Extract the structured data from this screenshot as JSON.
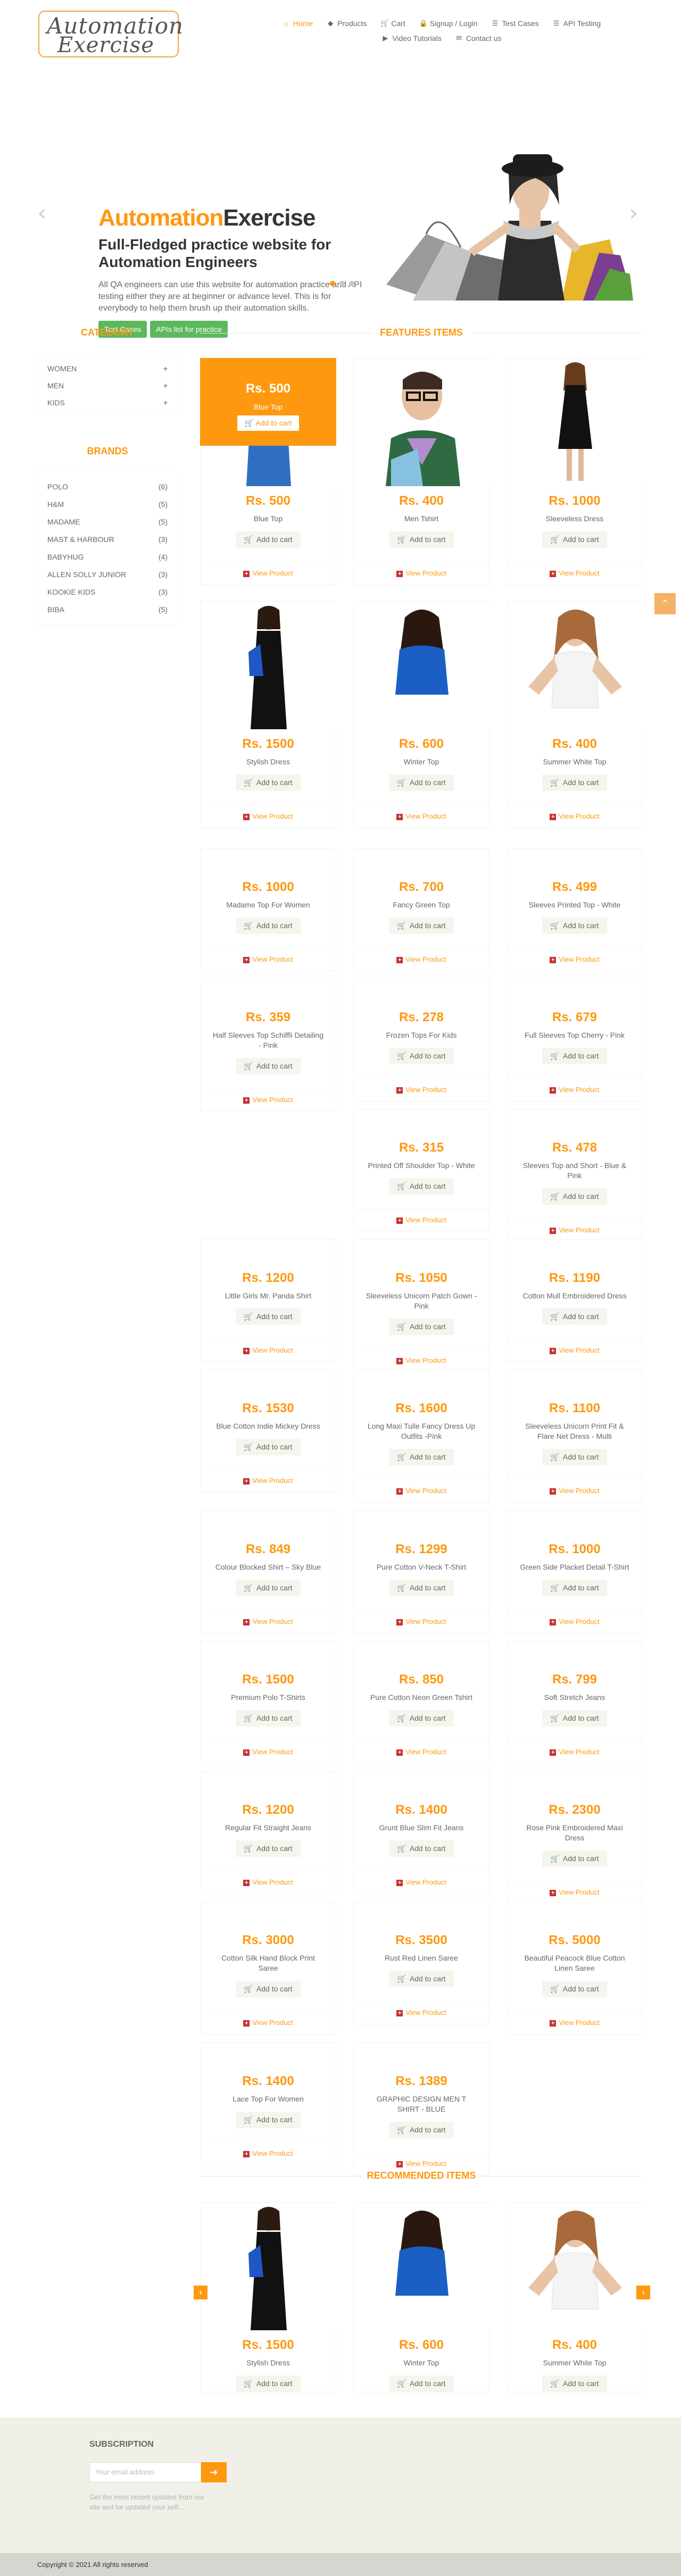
{
  "logo": {
    "line1": "Automation",
    "line2": "Exercise"
  },
  "nav": [
    {
      "label": "Home",
      "icon": "home-icon",
      "glyph": "⌂",
      "active": true
    },
    {
      "label": "Products",
      "icon": "tag-icon",
      "glyph": "◆",
      "active": false
    },
    {
      "label": "Cart",
      "icon": "cart-icon",
      "glyph": "🛒",
      "active": false
    },
    {
      "label": "Signup / Login",
      "icon": "lock-icon",
      "glyph": "🔒",
      "active": false
    },
    {
      "label": "Test Cases",
      "icon": "list-icon",
      "glyph": "☰",
      "active": false
    },
    {
      "label": "API Testing",
      "icon": "list-icon",
      "glyph": "☰",
      "active": false
    },
    {
      "label": "Video Tutorials",
      "icon": "youtube-icon",
      "glyph": "▶",
      "active": false
    },
    {
      "label": "Contact us",
      "icon": "envelope-icon",
      "glyph": "✉",
      "active": false
    }
  ],
  "slider": {
    "brand_a": "Automation",
    "brand_b": "Exercise",
    "subtitle": "Full-Fledged practice website for Automation Engineers",
    "description": "All QA engineers can use this website for automation practice and API testing either they are at beginner or advance level. This is for everybody to help them brush up their automation skills.",
    "btn_test_cases": "Test Cases",
    "btn_apis": "APIs list for practice",
    "arrow_left": "‹",
    "arrow_right": "›"
  },
  "sidebar": {
    "category_title": "CATEGORY",
    "categories": [
      "WOMEN",
      "MEN",
      "KIDS"
    ],
    "brands_title": "BRANDS",
    "brands": [
      {
        "name": "POLO",
        "count": "(6)"
      },
      {
        "name": "H&M",
        "count": "(5)"
      },
      {
        "name": "MADAME",
        "count": "(5)"
      },
      {
        "name": "MAST & HARBOUR",
        "count": "(3)"
      },
      {
        "name": "BABYHUG",
        "count": "(4)"
      },
      {
        "name": "ALLEN SOLLY JUNIOR",
        "count": "(3)"
      },
      {
        "name": "KOOKIE KIDS",
        "count": "(3)"
      },
      {
        "name": "BIBA",
        "count": "(5)"
      }
    ]
  },
  "features_title": "FEATURES ITEMS",
  "add_to_cart": "Add to cart",
  "view_product": "View Product",
  "overlay": {
    "price": "Rs. 500",
    "name": "Blue Top",
    "btn": "Add to cart"
  },
  "products": [
    {
      "price": "Rs. 500",
      "name": "Blue Top",
      "img": "blue-top",
      "active": true
    },
    {
      "price": "Rs. 400",
      "name": "Men Tshirt",
      "img": "men-tshirt"
    },
    {
      "price": "Rs. 1000",
      "name": "Sleeveless Dress",
      "img": "sleeveless-dress"
    },
    {
      "price": "Rs. 1500",
      "name": "Stylish Dress",
      "img": "stylish-dress"
    },
    {
      "price": "Rs. 600",
      "name": "Winter Top",
      "img": "winter-top"
    },
    {
      "price": "Rs. 400",
      "name": "Summer White Top",
      "img": "summer-white-top"
    },
    {
      "price": "Rs. 1000",
      "name": "Madame Top For Women"
    },
    {
      "price": "Rs. 700",
      "name": "Fancy Green Top"
    },
    {
      "price": "Rs. 499",
      "name": "Sleeves Printed Top - White"
    },
    {
      "price": "Rs. 359",
      "name": "Half Sleeves Top Schiffli Detailing - Pink"
    },
    {
      "price": "Rs. 278",
      "name": "Frozen Tops For Kids"
    },
    {
      "price": "Rs. 679",
      "name": "Full Sleeves Top Cherry - Pink"
    },
    {
      "price": "Rs. 315",
      "name": "Printed Off Shoulder Top - White"
    },
    {
      "price": "Rs. 478",
      "name": "Sleeves Top and Short - Blue & Pink"
    },
    {
      "price": "Rs. 1200",
      "name": "Little Girls Mr. Panda Shirt"
    },
    {
      "price": "Rs. 1050",
      "name": "Sleeveless Unicorn Patch Gown - Pink"
    },
    {
      "price": "Rs. 1190",
      "name": "Cotton Mull Embroidered Dress"
    },
    {
      "price": "Rs. 1530",
      "name": "Blue Cotton Indie Mickey Dress"
    },
    {
      "price": "Rs. 1600",
      "name": "Long Maxi Tulle Fancy Dress Up Outfits -Pink"
    },
    {
      "price": "Rs. 1100",
      "name": "Sleeveless Unicorn Print Fit & Flare Net Dress - Multi"
    },
    {
      "price": "Rs. 849",
      "name": "Colour Blocked Shirt – Sky Blue"
    },
    {
      "price": "Rs. 1299",
      "name": "Pure Cotton V-Neck T-Shirt"
    },
    {
      "price": "Rs. 1000",
      "name": "Green Side Placket Detail T-Shirt"
    },
    {
      "price": "Rs. 1500",
      "name": "Premium Polo T-Shirts"
    },
    {
      "price": "Rs. 850",
      "name": "Pure Cotton Neon Green Tshirt"
    },
    {
      "price": "Rs. 799",
      "name": "Soft Stretch Jeans"
    },
    {
      "price": "Rs. 1200",
      "name": "Regular Fit Straight Jeans"
    },
    {
      "price": "Rs. 1400",
      "name": "Grunt Blue Slim Fit Jeans"
    },
    {
      "price": "Rs. 2300",
      "name": "Rose Pink Embroidered Maxi Dress"
    },
    {
      "price": "Rs. 3000",
      "name": "Cotton Silk Hand Block Print Saree"
    },
    {
      "price": "Rs. 3500",
      "name": "Rust Red Linen Saree"
    },
    {
      "price": "Rs. 5000",
      "name": "Beautiful Peacock Blue Cotton Linen Saree"
    },
    {
      "price": "Rs. 1400",
      "name": "Lace Top For Women"
    },
    {
      "price": "Rs. 1389",
      "name": "GRAPHIC DESIGN MEN T SHIRT - BLUE"
    }
  ],
  "recommended_title": "RECOMMENDED ITEMS",
  "recommended": [
    {
      "price": "Rs. 1500",
      "name": "Stylish Dress",
      "img": "stylish-dress"
    },
    {
      "price": "Rs. 600",
      "name": "Winter Top",
      "img": "winter-top"
    },
    {
      "price": "Rs. 400",
      "name": "Summer White Top",
      "img": "summer-white-top"
    }
  ],
  "rec_arrow_left": "‹",
  "rec_arrow_right": "›",
  "scroll_up": "⌃",
  "footer": {
    "subscription_title": "SUBSCRIPTION",
    "email_placeholder": "Your email address",
    "note": "Get the most recent updates from our site and be updated your self...",
    "copyright": "Copyright © 2021 All rights reserved"
  },
  "colors": {
    "accent": "#fe980f",
    "green": "#5cb85c",
    "footer_bg": "#f0f0e9"
  }
}
